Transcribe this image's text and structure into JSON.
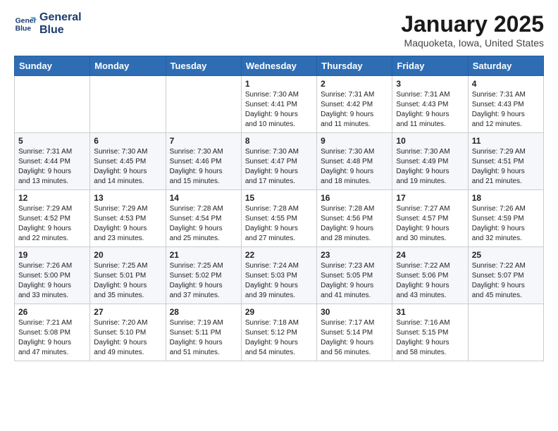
{
  "logo": {
    "line1": "General",
    "line2": "Blue"
  },
  "title": "January 2025",
  "subtitle": "Maquoketa, Iowa, United States",
  "days_of_week": [
    "Sunday",
    "Monday",
    "Tuesday",
    "Wednesday",
    "Thursday",
    "Friday",
    "Saturday"
  ],
  "weeks": [
    [
      {
        "day": "",
        "info": ""
      },
      {
        "day": "",
        "info": ""
      },
      {
        "day": "",
        "info": ""
      },
      {
        "day": "1",
        "info": "Sunrise: 7:30 AM\nSunset: 4:41 PM\nDaylight: 9 hours\nand 10 minutes."
      },
      {
        "day": "2",
        "info": "Sunrise: 7:31 AM\nSunset: 4:42 PM\nDaylight: 9 hours\nand 11 minutes."
      },
      {
        "day": "3",
        "info": "Sunrise: 7:31 AM\nSunset: 4:43 PM\nDaylight: 9 hours\nand 11 minutes."
      },
      {
        "day": "4",
        "info": "Sunrise: 7:31 AM\nSunset: 4:43 PM\nDaylight: 9 hours\nand 12 minutes."
      }
    ],
    [
      {
        "day": "5",
        "info": "Sunrise: 7:31 AM\nSunset: 4:44 PM\nDaylight: 9 hours\nand 13 minutes."
      },
      {
        "day": "6",
        "info": "Sunrise: 7:30 AM\nSunset: 4:45 PM\nDaylight: 9 hours\nand 14 minutes."
      },
      {
        "day": "7",
        "info": "Sunrise: 7:30 AM\nSunset: 4:46 PM\nDaylight: 9 hours\nand 15 minutes."
      },
      {
        "day": "8",
        "info": "Sunrise: 7:30 AM\nSunset: 4:47 PM\nDaylight: 9 hours\nand 17 minutes."
      },
      {
        "day": "9",
        "info": "Sunrise: 7:30 AM\nSunset: 4:48 PM\nDaylight: 9 hours\nand 18 minutes."
      },
      {
        "day": "10",
        "info": "Sunrise: 7:30 AM\nSunset: 4:49 PM\nDaylight: 9 hours\nand 19 minutes."
      },
      {
        "day": "11",
        "info": "Sunrise: 7:29 AM\nSunset: 4:51 PM\nDaylight: 9 hours\nand 21 minutes."
      }
    ],
    [
      {
        "day": "12",
        "info": "Sunrise: 7:29 AM\nSunset: 4:52 PM\nDaylight: 9 hours\nand 22 minutes."
      },
      {
        "day": "13",
        "info": "Sunrise: 7:29 AM\nSunset: 4:53 PM\nDaylight: 9 hours\nand 23 minutes."
      },
      {
        "day": "14",
        "info": "Sunrise: 7:28 AM\nSunset: 4:54 PM\nDaylight: 9 hours\nand 25 minutes."
      },
      {
        "day": "15",
        "info": "Sunrise: 7:28 AM\nSunset: 4:55 PM\nDaylight: 9 hours\nand 27 minutes."
      },
      {
        "day": "16",
        "info": "Sunrise: 7:28 AM\nSunset: 4:56 PM\nDaylight: 9 hours\nand 28 minutes."
      },
      {
        "day": "17",
        "info": "Sunrise: 7:27 AM\nSunset: 4:57 PM\nDaylight: 9 hours\nand 30 minutes."
      },
      {
        "day": "18",
        "info": "Sunrise: 7:26 AM\nSunset: 4:59 PM\nDaylight: 9 hours\nand 32 minutes."
      }
    ],
    [
      {
        "day": "19",
        "info": "Sunrise: 7:26 AM\nSunset: 5:00 PM\nDaylight: 9 hours\nand 33 minutes."
      },
      {
        "day": "20",
        "info": "Sunrise: 7:25 AM\nSunset: 5:01 PM\nDaylight: 9 hours\nand 35 minutes."
      },
      {
        "day": "21",
        "info": "Sunrise: 7:25 AM\nSunset: 5:02 PM\nDaylight: 9 hours\nand 37 minutes."
      },
      {
        "day": "22",
        "info": "Sunrise: 7:24 AM\nSunset: 5:03 PM\nDaylight: 9 hours\nand 39 minutes."
      },
      {
        "day": "23",
        "info": "Sunrise: 7:23 AM\nSunset: 5:05 PM\nDaylight: 9 hours\nand 41 minutes."
      },
      {
        "day": "24",
        "info": "Sunrise: 7:22 AM\nSunset: 5:06 PM\nDaylight: 9 hours\nand 43 minutes."
      },
      {
        "day": "25",
        "info": "Sunrise: 7:22 AM\nSunset: 5:07 PM\nDaylight: 9 hours\nand 45 minutes."
      }
    ],
    [
      {
        "day": "26",
        "info": "Sunrise: 7:21 AM\nSunset: 5:08 PM\nDaylight: 9 hours\nand 47 minutes."
      },
      {
        "day": "27",
        "info": "Sunrise: 7:20 AM\nSunset: 5:10 PM\nDaylight: 9 hours\nand 49 minutes."
      },
      {
        "day": "28",
        "info": "Sunrise: 7:19 AM\nSunset: 5:11 PM\nDaylight: 9 hours\nand 51 minutes."
      },
      {
        "day": "29",
        "info": "Sunrise: 7:18 AM\nSunset: 5:12 PM\nDaylight: 9 hours\nand 54 minutes."
      },
      {
        "day": "30",
        "info": "Sunrise: 7:17 AM\nSunset: 5:14 PM\nDaylight: 9 hours\nand 56 minutes."
      },
      {
        "day": "31",
        "info": "Sunrise: 7:16 AM\nSunset: 5:15 PM\nDaylight: 9 hours\nand 58 minutes."
      },
      {
        "day": "",
        "info": ""
      }
    ]
  ]
}
